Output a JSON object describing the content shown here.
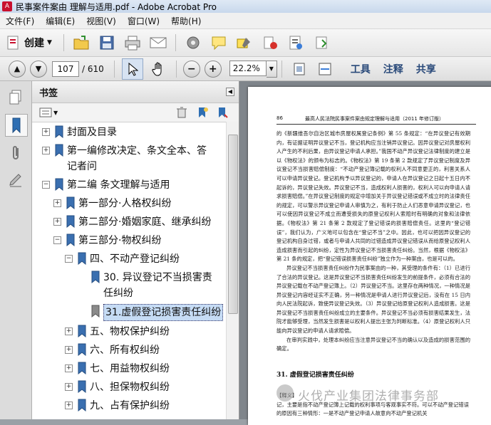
{
  "window": {
    "title": "民事案件案由 理解与适用.pdf - Adobe Acrobat Pro"
  },
  "menu": [
    "文件(F)",
    "编辑(E)",
    "视图(V)",
    "窗口(W)",
    "帮助(H)"
  ],
  "toolbar": {
    "create_label": "创建"
  },
  "nav": {
    "page_current": "107",
    "page_total": "/ 610",
    "zoom": "22.2%"
  },
  "right_links": [
    "工具",
    "注释",
    "共享"
  ],
  "bookmarks": {
    "title": "书签",
    "items": [
      {
        "label": "封面及目录"
      },
      {
        "label": "第一编修改决定、条文全本、答记者问"
      },
      {
        "label": "第二编 条文理解与适用"
      },
      {
        "label": "第一部分·人格权纠纷"
      },
      {
        "label": "第二部分·婚姻家庭、继承纠纷"
      },
      {
        "label": "第三部分·物权纠纷"
      },
      {
        "label": "四、不动产登记纠纷"
      },
      {
        "label": "30. 异议登记不当损害责任纠纷"
      },
      {
        "label": "31.虚假登记损害责任纠纷"
      },
      {
        "label": "五、物权保护纠纷"
      },
      {
        "label": "六、所有权纠纷"
      },
      {
        "label": "七、用益物权纠纷"
      },
      {
        "label": "八、担保物权纠纷"
      },
      {
        "label": "九、占有保护纠纷"
      }
    ]
  },
  "page": {
    "number": "86",
    "header": "最高人民法院民事案件案由规定理解与适用（2011 年修订版）",
    "paragraphs": [
      "的《新疆维吾尔自治区城市房屋权属登记条例》第 55 条规定：“在异议登记有效期内，有证据证明异议登记不当，登记机构应当注销异议登记。因异议登记对房屋权利人产生的不利后果，由异议登记申请人承担。”我国不动产异议登记法律制度的建立是以《物权法》的颁布为标志的。《物权法》第 19 条第 2 款规定了异议登记制度及异议登记不当损害赔偿制度：“不动产登记簿记载的权利人不同意更正的，利害关系人可以申请异议登记。登记机构予以异议登记的，申请人在异议登记之日起十五日内不起诉的，异议登记失效。异议登记不当，造成权利人损害的，权利人可以向申请人请求损害赔偿。”在异议登记制度的规定中增加关于异议登记错误或不成立时的法律责任的规定，可以警示异议登记申请人审慎为之，有利于防止人们恶意申请异议登记，也可以使因异议登记不成立而遭受损失的原登记权利人索赔时有明确的对象和法律依据。《物权法》第 21 条第 2 款规定了登记错误的损害赔偿责任。这里的“登记错误”，我们认为，广义地可以包含在“登记不当”之中。因此，也可以把因异议登记的登记机构自身过错，或者与申请人共同的过错造成异议登记错误从而给原登记权利人造成损害而引起的纠纷，定性为异议登记不当损害责任纠纷。当然，根据《物权法》第 21 条的规定，把“登记错误损害责任纠纷”独立作为一种案由，也是可以的。",
      "异议登记不当损害责任纠纷作为民事案由的一种，其受理的条件有：（1）已进行了合法的异议登记。这是异议登记不当损害责任纠纷发生的前提条件，必须有合法的异议登记载在不动产登记簿上。（2）异议登记不当。这里存在两种情况，一种情况是异议登记内容经证实不正确，另一种情况是申请人进行异议登记后，没有在 15 日内向人民法院起诉，致使异议登记失效。（3）异议登记给原登记权利人造成损害。这是异议登记不当损害责任纠纷成立的主要条件。异议登记不当必须有损害结果发生，法院才能够受理，当然发生损害是以权利人提出主张为判断标准。（4）原登记权利人只能向异议登记的申请人请求赔偿。",
      "在审判实践中，处理本纠纷应当注意异议登记不当的确认以及造成的损害范围的确定。"
    ],
    "section_title": "31. 虚假登记损害责任纠纷",
    "subsection": "【释义】",
    "section_text": "记，主要是指不动产登记簿上记载的权利事项与客观事实不符。可以不动产登记错误的原因有三种情形：一是不动产登记申请人故意向不动产登记机关"
  },
  "watermark": "火伐产业集团法律事务部"
}
